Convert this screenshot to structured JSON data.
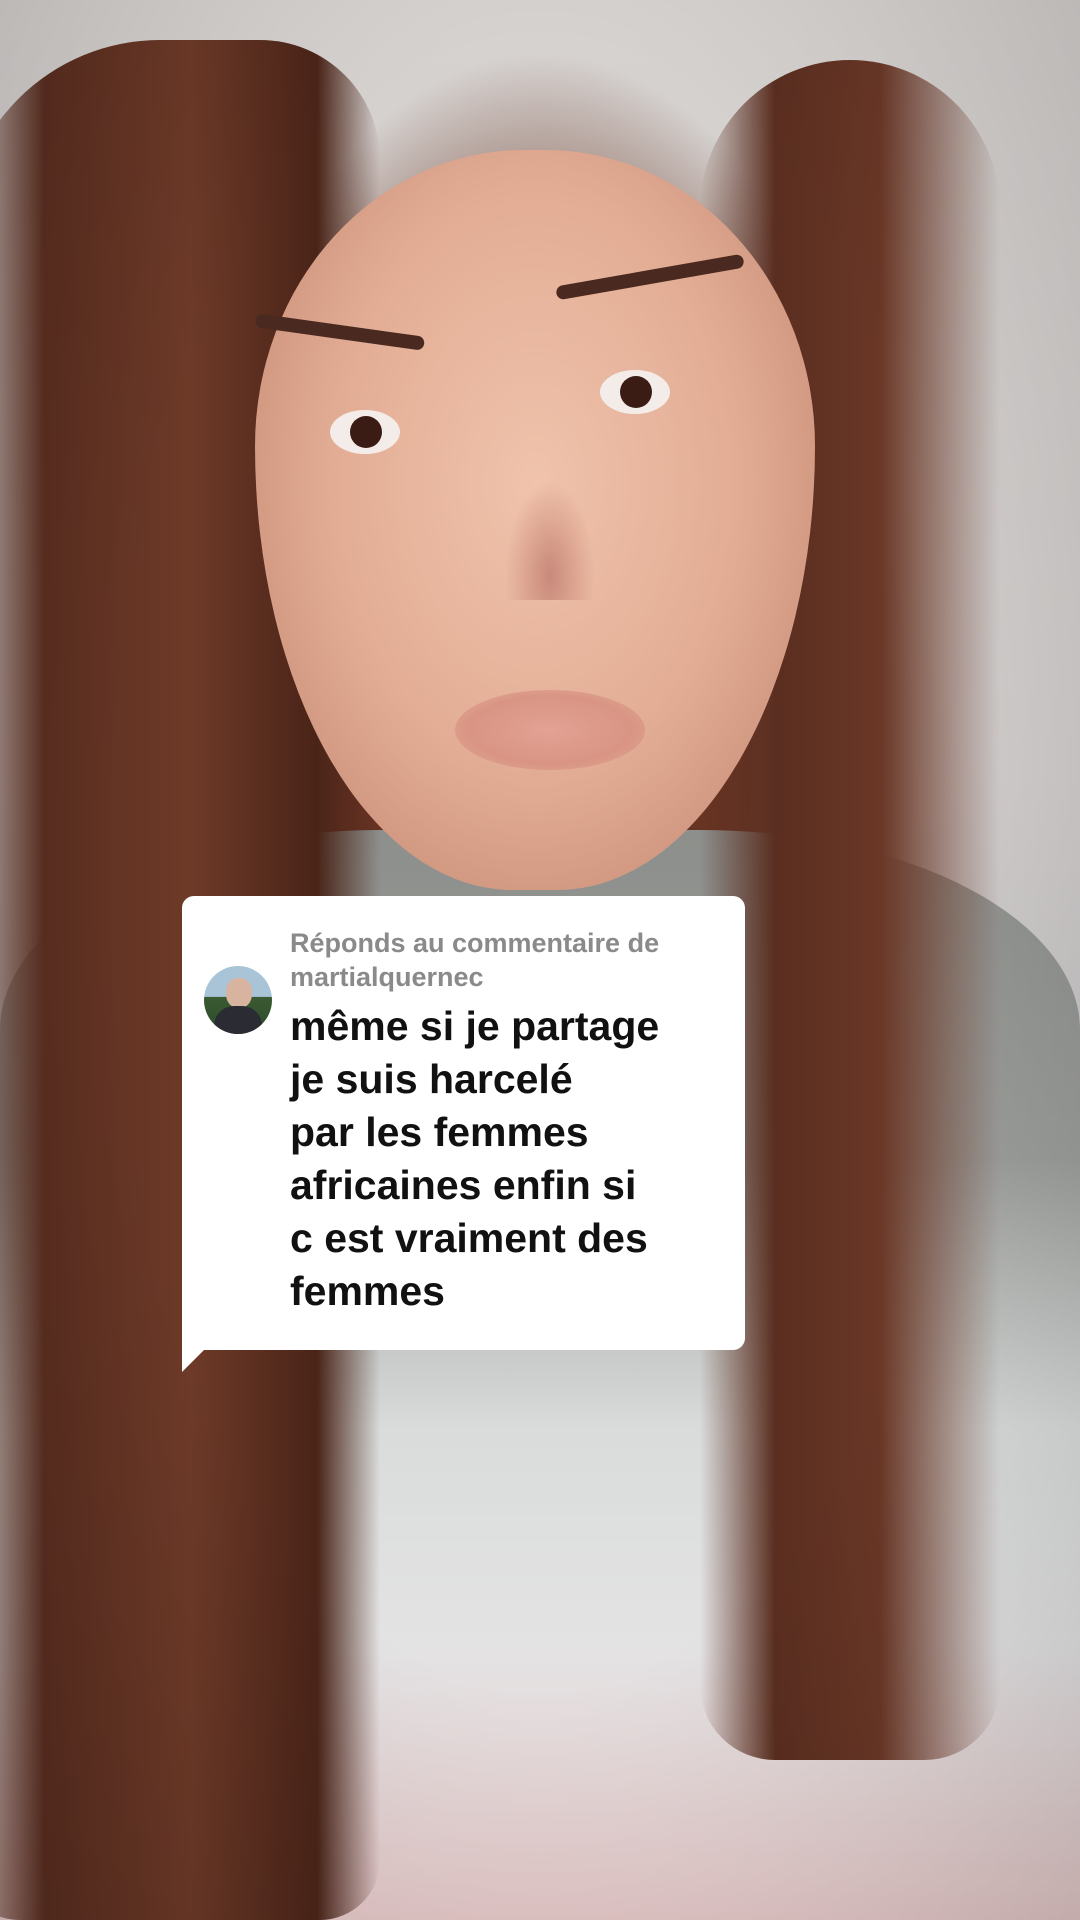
{
  "reply_card": {
    "header": "Réponds au commentaire de",
    "username": "martialquernec",
    "comment": "même si je partage\nje suis harcelé\npar les femmes\nafricaines enfin si\nc est vraiment des\nfemmes"
  }
}
